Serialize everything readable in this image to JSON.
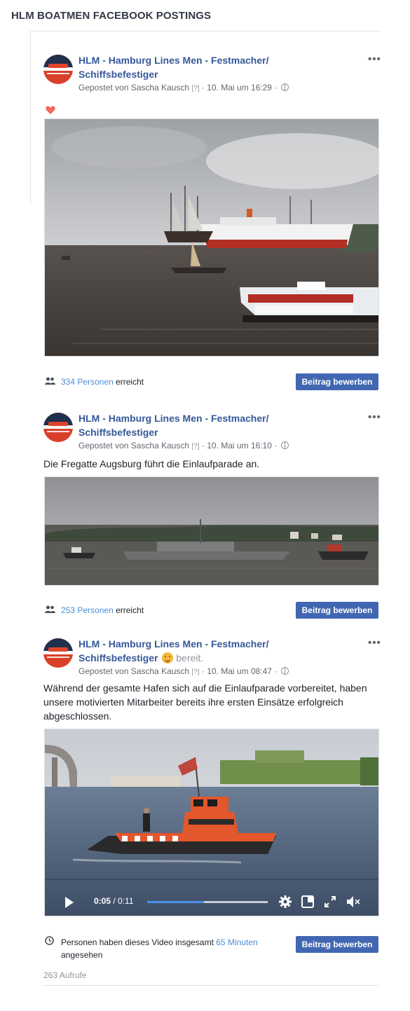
{
  "page_title": "HLM BOATMEN FACEBOOK POSTINGS",
  "common": {
    "page_name": "HLM - Hamburg Lines Men - Festmacher/ Schiffsbefestiger",
    "posted_by": "Gepostet von Sascha Kausch",
    "question_mark": "[?]",
    "boost_label": "Beitrag bewerben",
    "reach_people_suffix": "Personen",
    "reach_suffix": "erreicht",
    "more_label": "•••"
  },
  "posts": [
    {
      "date": "10. Mai um 16:29",
      "reaction_icon": "heart-icon",
      "reach_count": "334"
    },
    {
      "date": "10. Mai um 16:10",
      "text": "Die Fregatte Augsburg führt die Einlaufparade an.",
      "reach_count": "253"
    },
    {
      "feeling": "bereit.",
      "date": "10. Mai um 08:47",
      "text": "Während der gesamte Hafen sich auf die Einlaufparade vorbereitet, haben unsere motivierten Mitarbeiter bereits ihre ersten Einsätze erfolgreich abgeschlossen.",
      "video": {
        "current_time": "0:05",
        "duration": "/ 0:11",
        "progress": 0.47,
        "controls": [
          "play-icon",
          "settings-icon",
          "mini-player-icon",
          "fullscreen-icon",
          "mute-icon"
        ]
      },
      "watch_text_before": "Personen haben dieses Video insgesamt",
      "watch_minutes": "65 Minuten",
      "watch_text_after": "angesehen",
      "views": "263 Aufrufe"
    }
  ],
  "colors": {
    "link_blue": "#365899",
    "boost_button": "#4267b2",
    "reach_link": "#4b8fd6"
  }
}
